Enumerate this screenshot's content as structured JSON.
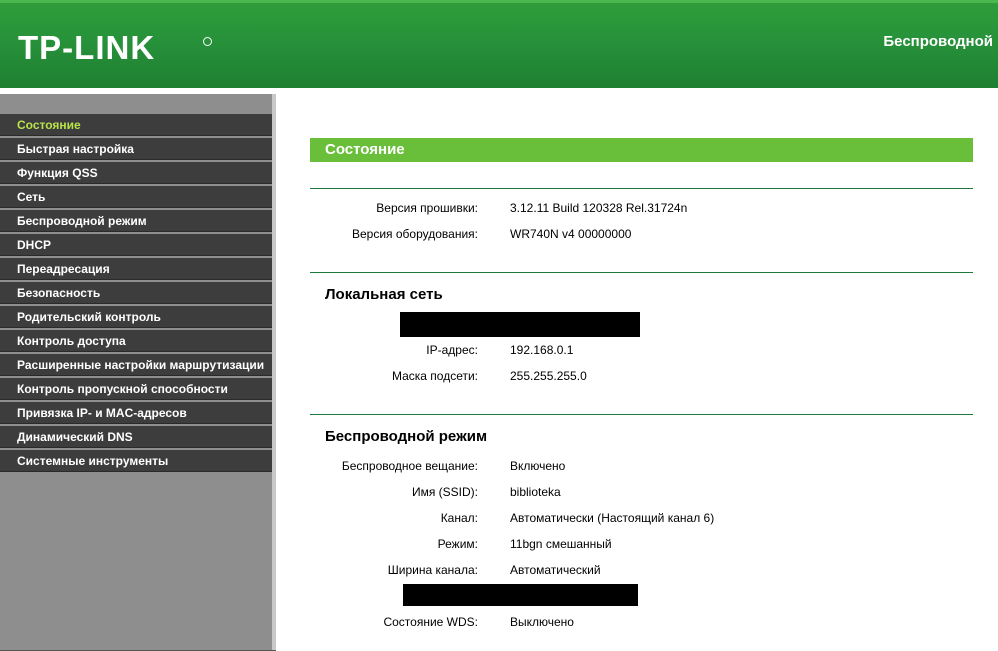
{
  "header": {
    "brand": "TP-LINK",
    "title": "Беспроводной"
  },
  "sidebar": {
    "items": [
      {
        "label": "Состояние",
        "active": true
      },
      {
        "label": "Быстрая настройка"
      },
      {
        "label": "Функция QSS"
      },
      {
        "label": "Сеть"
      },
      {
        "label": "Беспроводной режим"
      },
      {
        "label": "DHCP"
      },
      {
        "label": "Переадресация"
      },
      {
        "label": "Безопасность"
      },
      {
        "label": "Родительский контроль"
      },
      {
        "label": "Контроль доступа"
      },
      {
        "label": "Расширенные настройки маршрутизации"
      },
      {
        "label": "Контроль пропускной способности"
      },
      {
        "label": "Привязка IP- и MAC-адресов"
      },
      {
        "label": "Динамический DNS"
      },
      {
        "label": "Системные инструменты"
      }
    ]
  },
  "main": {
    "section_title": "Состояние",
    "firmware": {
      "label": "Версия прошивки:",
      "value": "3.12.11 Build 120328 Rel.31724n"
    },
    "hardware": {
      "label": "Версия оборудования:",
      "value": "WR740N v4 00000000"
    },
    "lan": {
      "title": "Локальная сеть",
      "ip": {
        "label": "IP-адрес:",
        "value": "192.168.0.1"
      },
      "mask": {
        "label": "Маска подсети:",
        "value": "255.255.255.0"
      }
    },
    "wireless": {
      "title": "Беспроводной режим",
      "broadcast": {
        "label": "Беспроводное вещание:",
        "value": "Включено"
      },
      "ssid": {
        "label": "Имя (SSID):",
        "value": "biblioteka"
      },
      "channel": {
        "label": "Канал:",
        "value": "Автоматически (Настоящий канал 6)"
      },
      "mode": {
        "label": "Режим:",
        "value": "11bgn смешанный"
      },
      "width": {
        "label": "Ширина канала:",
        "value": "Автоматический"
      },
      "wds": {
        "label": "Состояние WDS:",
        "value": "Выключено"
      }
    }
  }
}
